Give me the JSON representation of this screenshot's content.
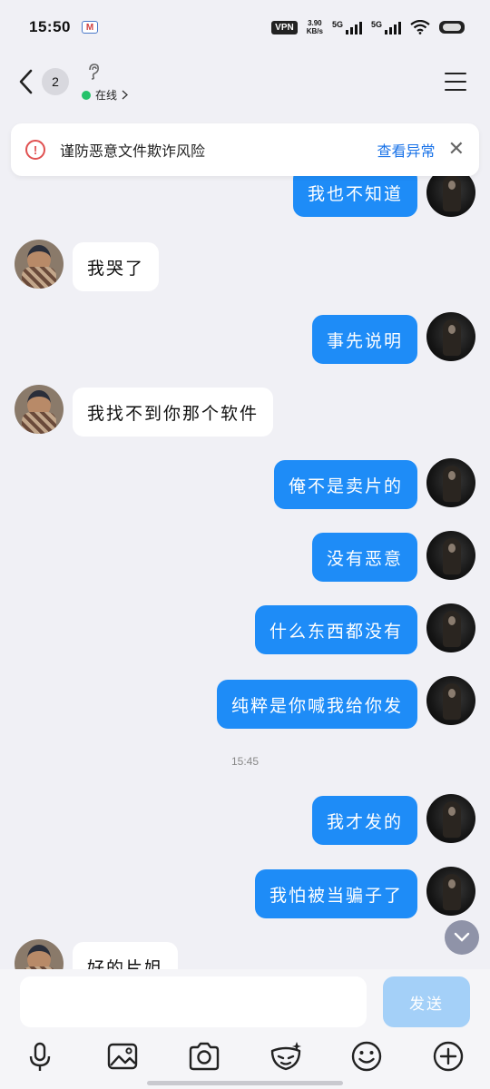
{
  "status_bar": {
    "time": "15:50",
    "mail_glyph": "M",
    "vpn": "VPN",
    "speed_value": "3.90",
    "speed_unit": "KB/s",
    "net1": "5G",
    "net2": "5G"
  },
  "header": {
    "unread_count": "2",
    "presence_status": "在线",
    "presence_color": "#25c26a"
  },
  "warning": {
    "text": "谨防恶意文件欺诈风险",
    "link_label": "查看异常",
    "icon": "warning-circle-icon",
    "accent": "#e05050"
  },
  "messages": [
    {
      "sender": "self",
      "text": "我也不知道"
    },
    {
      "sender": "other",
      "text": "我哭了"
    },
    {
      "sender": "self",
      "text": "事先说明"
    },
    {
      "sender": "other",
      "text": "我找不到你那个软件"
    },
    {
      "sender": "self",
      "text": "俺不是卖片的"
    },
    {
      "sender": "self",
      "text": "没有恶意"
    },
    {
      "sender": "self",
      "text": "什么东西都没有"
    },
    {
      "sender": "self",
      "text": "纯粹是你喊我给你发"
    },
    {
      "sender": "self",
      "text": "我才发的"
    },
    {
      "sender": "self",
      "text": "我怕被当骗子了"
    },
    {
      "sender": "other",
      "text": "好的片姐"
    }
  ],
  "timestamp": "15:45",
  "composer": {
    "input_value": "",
    "send_label": "发送"
  },
  "toolbar_icons": [
    "microphone-icon",
    "image-icon",
    "camera-icon",
    "sticker-icon",
    "emoji-icon",
    "plus-icon"
  ],
  "colors": {
    "self_bubble": "#1e8cf7",
    "other_bubble": "#ffffff",
    "background": "#f0f0f5",
    "send_button": "#a4d0f8"
  }
}
